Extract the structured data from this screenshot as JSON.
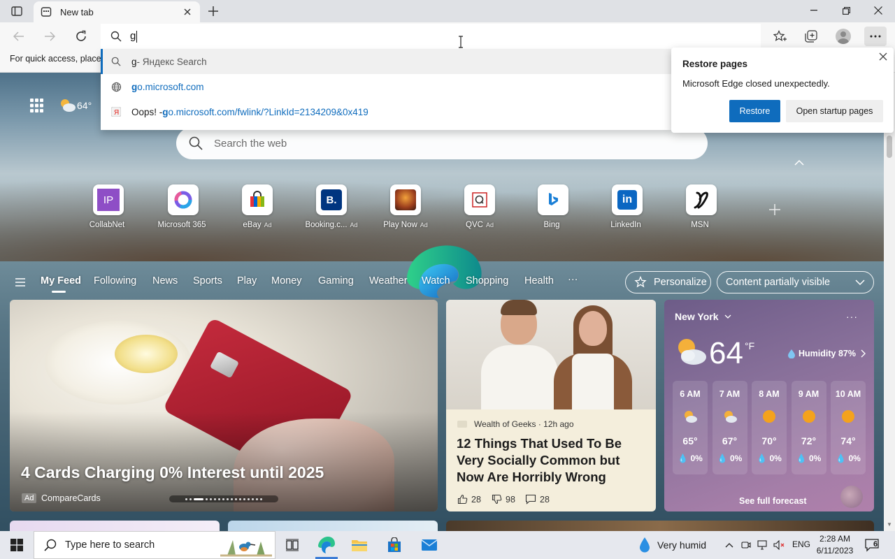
{
  "tab": {
    "title": "New tab"
  },
  "omnibox": {
    "value": "g"
  },
  "favorites_bar": {
    "hint": "For quick access, place y"
  },
  "suggestions": [
    {
      "prefix": "g",
      "text": " - Яндекс Search"
    },
    {
      "match": "g",
      "rest": "o.microsoft.com"
    },
    {
      "label": "Oops! - ",
      "match": "g",
      "rest": "o.microsoft.com/fwlink/?LinkId=2134209&0x419"
    }
  ],
  "restore": {
    "title": "Restore pages",
    "message": "Microsoft Edge closed unexpectedly.",
    "primary": "Restore",
    "secondary": "Open startup pages"
  },
  "ntp": {
    "weather_mini": "64°",
    "search_placeholder": "Search the web"
  },
  "quick_links": [
    {
      "label": "CollabNet",
      "ad": ""
    },
    {
      "label": "Microsoft 365",
      "ad": ""
    },
    {
      "label": "eBay",
      "ad": "Ad"
    },
    {
      "label": "Booking.c...",
      "ad": "Ad"
    },
    {
      "label": "Play Now",
      "ad": "Ad"
    },
    {
      "label": "QVC",
      "ad": "Ad"
    },
    {
      "label": "Bing",
      "ad": ""
    },
    {
      "label": "LinkedIn",
      "ad": ""
    },
    {
      "label": "MSN",
      "ad": ""
    }
  ],
  "feed_nav": {
    "items": [
      "My Feed",
      "Following",
      "News",
      "Sports",
      "Play",
      "Money",
      "Gaming",
      "Weather",
      "Watch",
      "Shopping",
      "Health"
    ],
    "more": "···",
    "personalize": "Personalize",
    "content_visibility": "Content partially visible"
  },
  "card_main": {
    "headline": "4 Cards Charging 0% Interest until 2025",
    "ad_badge": "Ad",
    "source": "CompareCards"
  },
  "card_2": {
    "source": "Wealth of Geeks · 12h ago",
    "title": "12 Things That Used To Be Very Socially Common but Now Are Horribly Wrong",
    "likes": "28",
    "dislikes": "98",
    "comments": "28"
  },
  "weather_card": {
    "city": "New York",
    "more": "···",
    "temp": "64",
    "unit": "°F",
    "humidity": "Humidity 87%",
    "hours": [
      {
        "time": "6 AM",
        "temp": "65°",
        "precip": "0%",
        "icon": "partly-cloudy-icon"
      },
      {
        "time": "7 AM",
        "temp": "67°",
        "precip": "0%",
        "icon": "partly-cloudy-icon"
      },
      {
        "time": "8 AM",
        "temp": "70°",
        "precip": "0%",
        "icon": "sun-icon"
      },
      {
        "time": "9 AM",
        "temp": "72°",
        "precip": "0%",
        "icon": "sun-icon"
      },
      {
        "time": "10 AM",
        "temp": "74°",
        "precip": "0%",
        "icon": "sun-icon"
      }
    ],
    "forecast_link": "See full forecast"
  },
  "taskbar": {
    "search_placeholder": "Type here to search",
    "weather": "Very humid",
    "language": "ENG",
    "time": "2:28 AM",
    "date": "6/11/2023",
    "notifications": "6"
  },
  "colors": {
    "accent": "#0f6cbd",
    "weather_card": "#88709a"
  }
}
